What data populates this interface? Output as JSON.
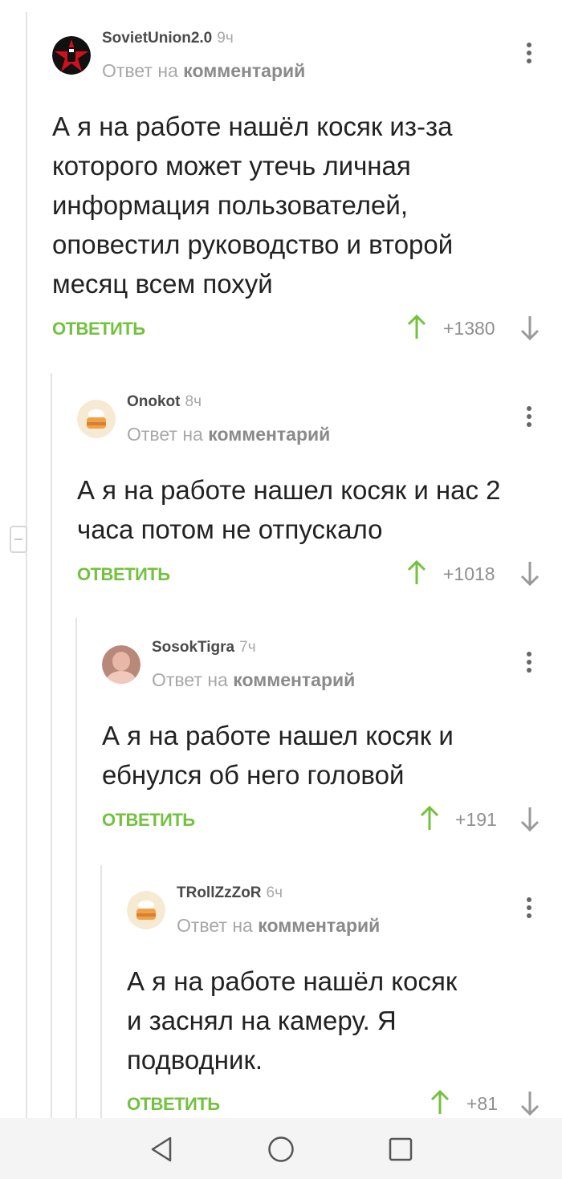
{
  "comments": [
    {
      "username": "SovietUnion2.0",
      "time": "9ч",
      "reply_prefix": "Ответ на",
      "reply_target": "комментарий",
      "lines": [
        "А я на работе нашёл косяк из-за",
        "которого может утечь личная",
        "информация пользователей,",
        "оповестил руководство и второй",
        "месяц всем похуй"
      ],
      "reply_label": "ОТВЕТИТЬ",
      "rating": "+1380",
      "avatar_icon": "red-star-fist-icon"
    },
    {
      "username": "Onokot",
      "time": "8ч",
      "reply_prefix": "Ответ на",
      "reply_target": "комментарий",
      "lines": [
        "А я на работе нашел косяк и нас 2",
        "часа потом не отпускало"
      ],
      "reply_label": "ОТВЕТИТЬ",
      "rating": "+1018",
      "avatar_icon": "default-cake-avatar-icon"
    },
    {
      "username": "SosokTigra",
      "time": "7ч",
      "reply_prefix": "Ответ на",
      "reply_target": "комментарий",
      "lines": [
        "А я на работе нашел косяк и",
        "ебнулся об него головой"
      ],
      "reply_label": "ОТВЕТИТЬ",
      "rating": "+191",
      "avatar_icon": "photo-avatar-icon"
    },
    {
      "username": "TRollZzZoR",
      "time": "6ч",
      "reply_prefix": "Ответ на",
      "reply_target": "комментарий",
      "lines": [
        "А я на работе нашёл косяк",
        "и заснял на камеру. Я",
        "подводник."
      ],
      "reply_label": "ОТВЕТИТЬ",
      "rating": "+81",
      "avatar_icon": "default-cake-avatar-icon"
    }
  ],
  "navbar": {
    "back_icon": "triangle-back-icon",
    "home_icon": "circle-home-icon",
    "recents_icon": "square-recents-icon"
  },
  "colors": {
    "accent_green": "#73c13e",
    "text": "#222222",
    "muted": "#a8a8a8"
  }
}
